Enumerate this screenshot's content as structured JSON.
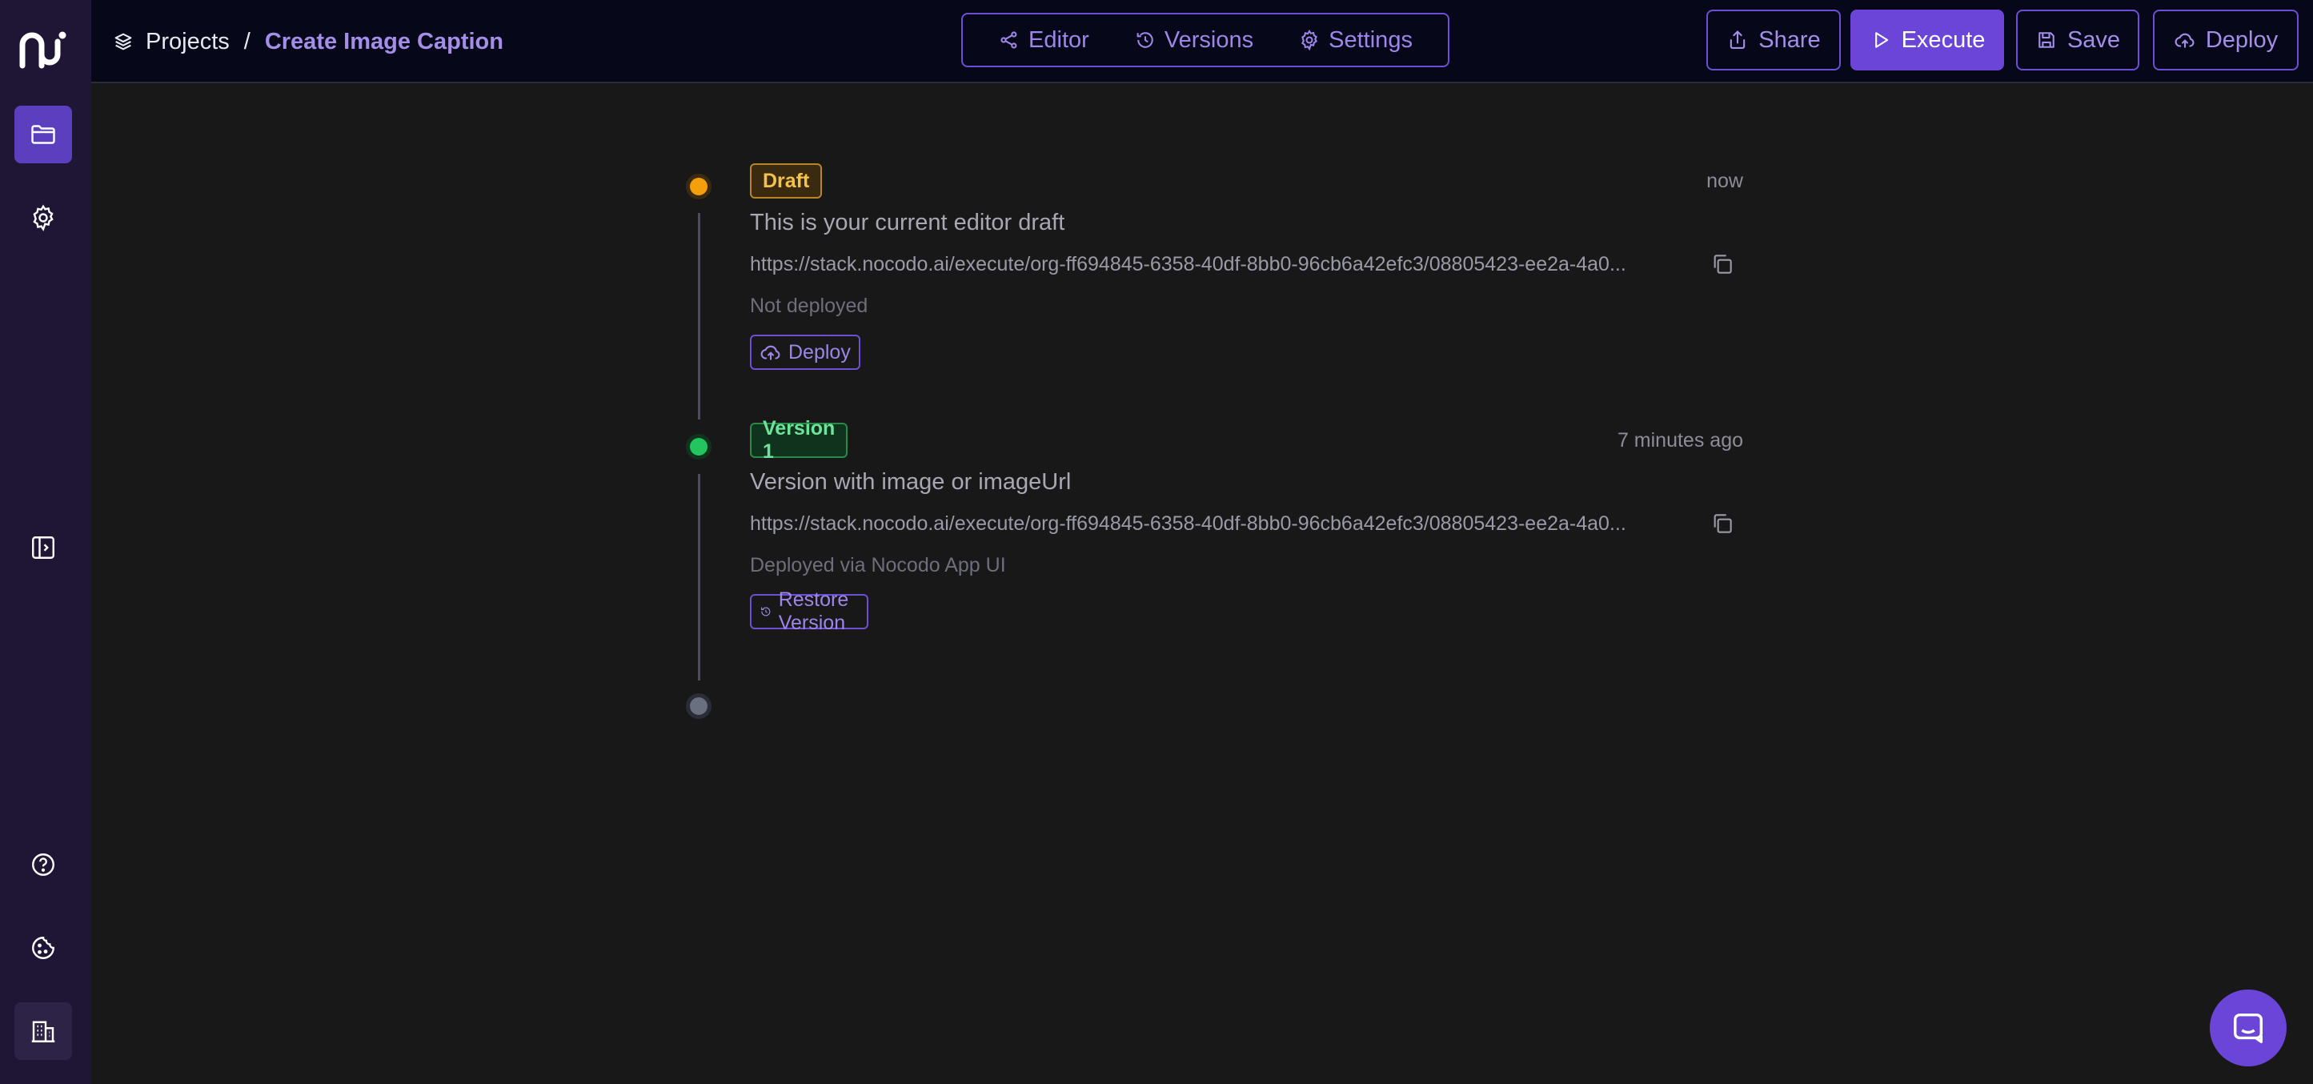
{
  "header": {
    "breadcrumb_root": "Projects",
    "breadcrumb_separator": "/",
    "project_title": "Create Image Caption"
  },
  "tabs": [
    {
      "label": "Editor",
      "icon": "share-nodes-icon"
    },
    {
      "label": "Versions",
      "icon": "history-icon"
    },
    {
      "label": "Settings",
      "icon": "gear-icon"
    }
  ],
  "toolbar": {
    "share_label": "Share",
    "execute_label": "Execute",
    "save_label": "Save",
    "deploy_label": "Deploy"
  },
  "versions": [
    {
      "badge": "Draft",
      "title": "This is your current editor draft",
      "url": "https://stack.nocodo.ai/execute/org-ff694845-6358-40df-8bb0-96cb6a42efc3/08805423-ee2a-4a0...",
      "status": "Not deployed",
      "time": "now",
      "action_label": "Deploy",
      "dot_color": "#f59e0b"
    },
    {
      "badge": "Version 1",
      "title": "Version with image or imageUrl",
      "url": "https://stack.nocodo.ai/execute/org-ff694845-6358-40df-8bb0-96cb6a42efc3/08805423-ee2a-4a0...",
      "status": "Deployed via Nocodo App UI",
      "time": "7 minutes ago",
      "action_label": "Restore Version",
      "dot_color": "#22c55e"
    }
  ],
  "colors": {
    "accent": "#6b45d8",
    "sidebar": "#1f1535",
    "topbar": "#07071a",
    "background": "#181818"
  }
}
